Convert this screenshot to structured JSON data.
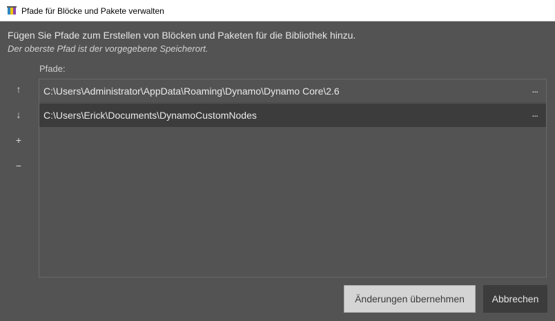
{
  "window": {
    "title": "Pfade für Blöcke und Pakete verwalten",
    "icon": "dynamo-app-icon"
  },
  "dialog": {
    "description": "Fügen Sie Pfade zum Erstellen von Blöcken und Paketen für die Bibliothek hinzu.",
    "hint": "Der oberste Pfad ist der vorgegebene Speicherort.",
    "paths_label": "Pfade:"
  },
  "side_buttons": {
    "up": "↑",
    "down": "↓",
    "add": "+",
    "remove": "−"
  },
  "paths": [
    {
      "path": "C:\\Users\\Administrator\\AppData\\Roaming\\Dynamo\\Dynamo Core\\2.6",
      "browse": "..."
    },
    {
      "path": "C:\\Users\\Erick\\Documents\\DynamoCustomNodes",
      "browse": "...",
      "selected": true
    }
  ],
  "footer": {
    "apply_label": "Änderungen übernehmen",
    "cancel_label": "Abbrechen"
  },
  "colors": {
    "background": "#535353",
    "selected_row": "#3c3c3c",
    "apply_button": "#d4d4d4",
    "cancel_button": "#3c3c3c"
  }
}
